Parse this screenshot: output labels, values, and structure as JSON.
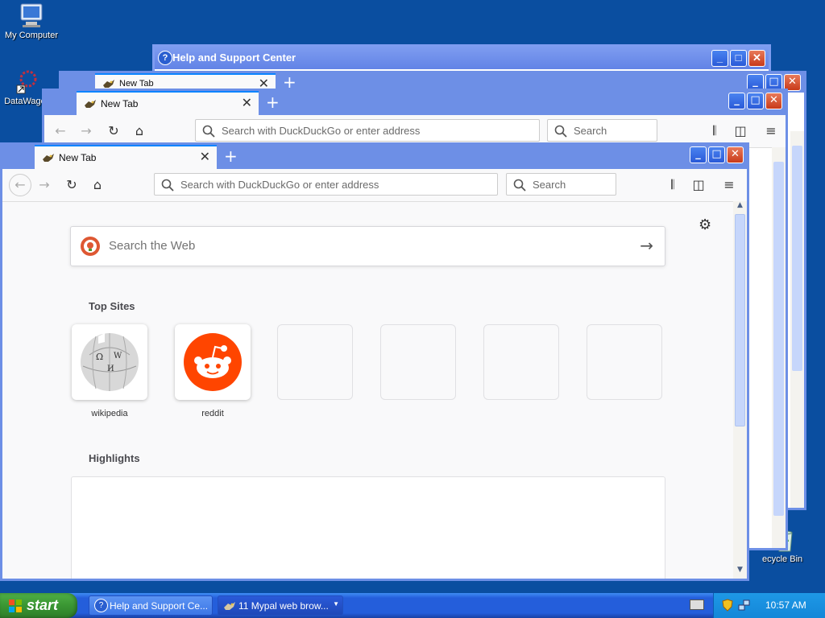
{
  "desktop": {
    "icons": [
      {
        "label": "My Computer",
        "icon": "computer-icon"
      },
      {
        "label": "DataWago",
        "icon": "datawago-icon"
      },
      {
        "label": "ecycle Bin",
        "icon": "recycle-bin-icon"
      }
    ]
  },
  "help_window": {
    "title": "Help and Support Center"
  },
  "browser_back2": {
    "tab_title": "New Tab"
  },
  "browser_back1": {
    "tab_title": "New Tab",
    "address_placeholder": "Search with DuckDuckGo or enter address",
    "search_placeholder": "Search"
  },
  "browser_front": {
    "tab_title": "New Tab",
    "address_placeholder": "Search with DuckDuckGo or enter address",
    "search_placeholder": "Search",
    "web_search_placeholder": "Search the Web",
    "top_sites_heading": "Top Sites",
    "top_sites": [
      {
        "label": "wikipedia",
        "icon": "wikipedia-icon"
      },
      {
        "label": "reddit",
        "icon": "reddit-icon"
      },
      {
        "label": ""
      },
      {
        "label": ""
      },
      {
        "label": ""
      },
      {
        "label": ""
      }
    ],
    "highlights_heading": "Highlights"
  },
  "taskbar": {
    "start_label": "start",
    "buttons": [
      {
        "label": "Help and Support Ce...",
        "icon": "help-icon"
      },
      {
        "label": "11 Mypal web brow...",
        "icon": "mypal-icon",
        "count": "11"
      }
    ],
    "clock": "10:57 AM"
  },
  "colors": {
    "desktop": "#0a4ea0",
    "title_bar": "#6d8fe6",
    "start_green": "#3a9633",
    "reddit": "#ff4500",
    "tab_accent": "#0a84ff"
  }
}
